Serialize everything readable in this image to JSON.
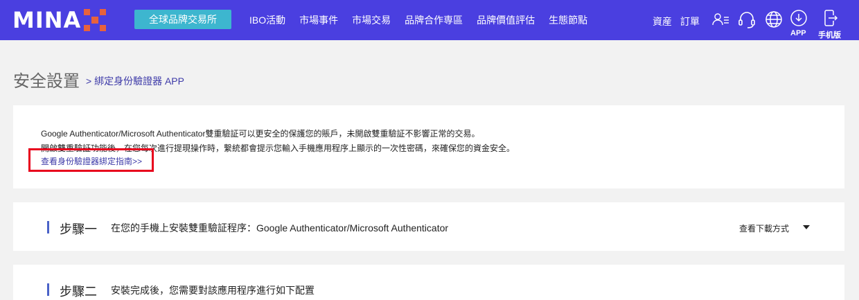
{
  "header": {
    "logo_text": "MINA",
    "brand_exchange_label": "全球品牌交易所",
    "nav": [
      "IBO活動",
      "市場事件",
      "市場交易",
      "品牌合作専區",
      "品牌價值評估",
      "生態節點"
    ],
    "assets_label": "資産",
    "orders_label": "訂單",
    "app_label": "APP",
    "mobile_label": "手机版",
    "icons": [
      "user-list-icon",
      "headset-icon",
      "globe-icon",
      "download-icon",
      "mobile-exit-icon"
    ],
    "colors": {
      "bar": "#4a3fe0",
      "brand_button": "#3db6cf",
      "logo_accent": "#e8623c"
    }
  },
  "page": {
    "title": "安全設置",
    "breadcrumb": "> 綁定身份驗證器 APP"
  },
  "info": {
    "line1": "Google Authenticator/Microsoft Authenticator雙重驗証可以更安全的保護您的賬戶，未開啟雙重驗証不影響正常的交易。",
    "line2": "開啟雙重驗証功能後，在您每次進行提現操作時，繫統都會提示您輸入手機應用程序上顯示的一次性密碼，來確保您的資金安全。",
    "guide_link": "查看身份驗證器綁定指南>>",
    "highlight_color": "#e8001c"
  },
  "steps": [
    {
      "title": "步驟一",
      "desc": "在您的手機上安裝雙重驗証程序：Google Authenticator/Microsoft Authenticator",
      "action": "查看下載方式"
    },
    {
      "title": "步驟二",
      "desc": "安裝完成後，您需要對該應用程序進行如下配置"
    }
  ]
}
